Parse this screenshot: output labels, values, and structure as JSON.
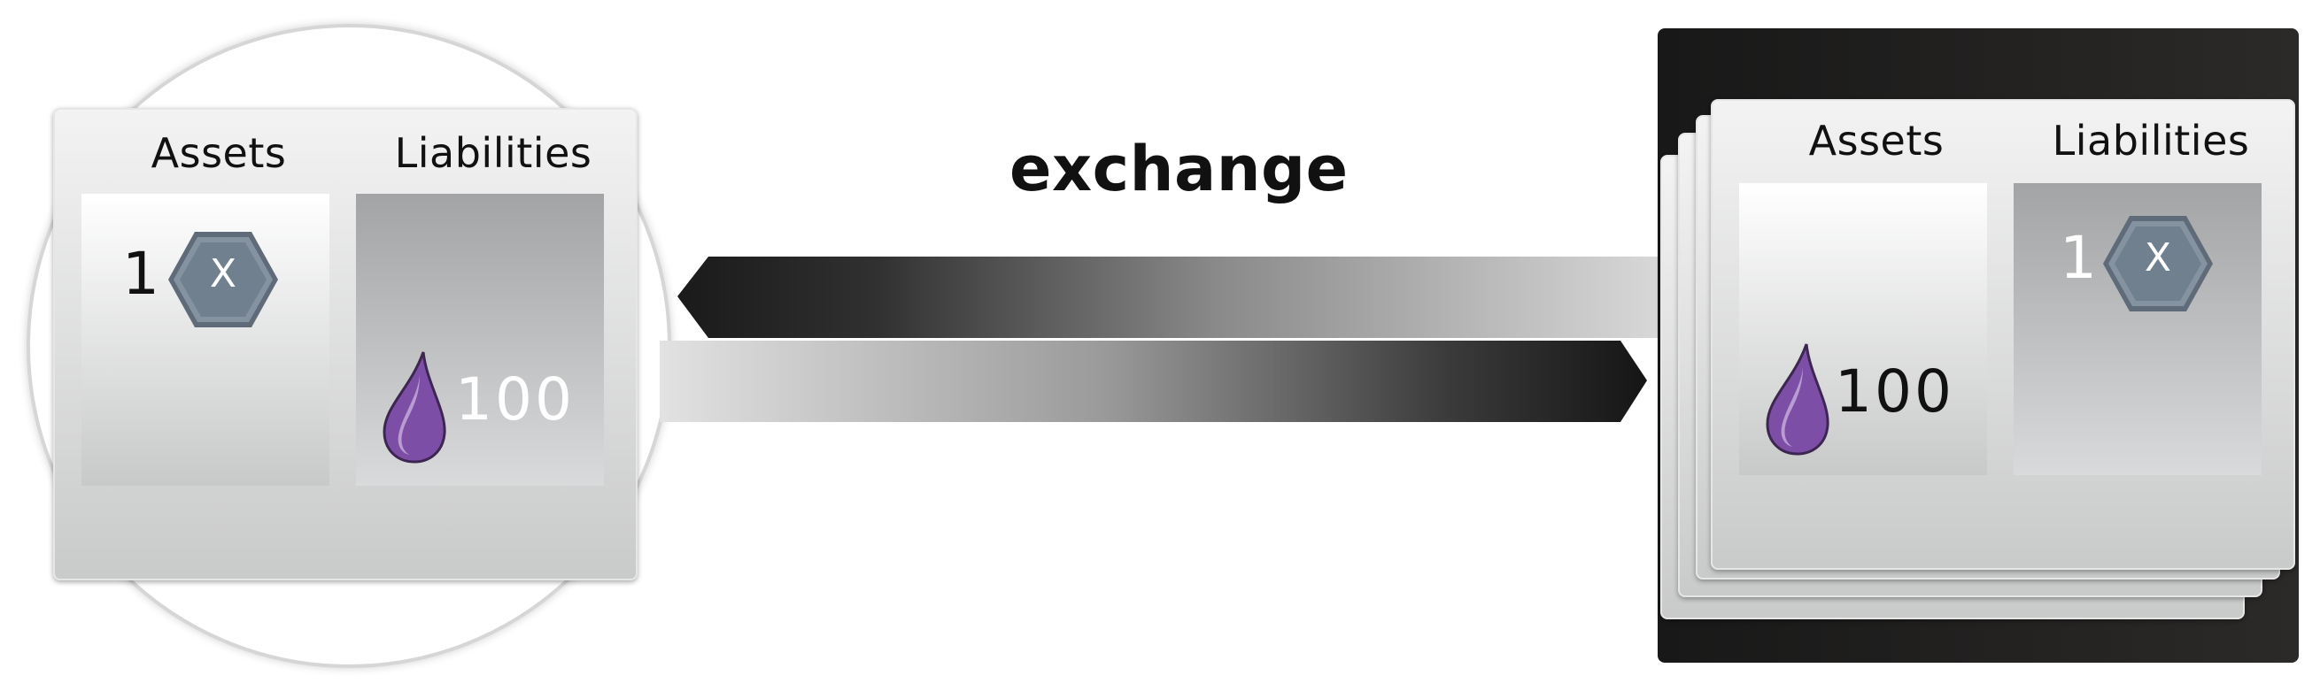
{
  "diagram": {
    "title": "exchange",
    "left_sheet": {
      "assets_header": "Assets",
      "liabilities_header": "Liabilities",
      "asset_count": "1",
      "asset_token": "X",
      "liability_amount": "100"
    },
    "right_sheet": {
      "assets_header": "Assets",
      "liabilities_header": "Liabilities",
      "asset_amount": "100",
      "liability_count": "1",
      "liability_token": "X"
    },
    "colors": {
      "token_fill": "#6f7f8e",
      "drop_purple": "#7d4ea6",
      "arrow_dark": "#1a1a1a",
      "arrow_light": "#d4d4d4",
      "stack_background": "#222020"
    },
    "icons": [
      "hexagon-token-icon",
      "purple-drop-icon"
    ]
  }
}
